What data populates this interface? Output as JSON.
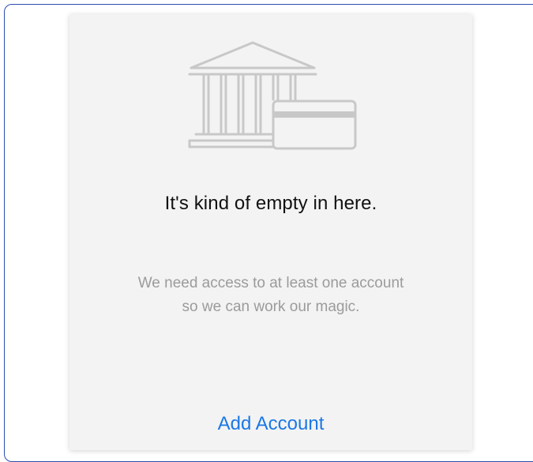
{
  "empty_state": {
    "title": "It's kind of empty in here.",
    "message_line1": "We need access to at least one account",
    "message_line2": "so we can work our magic.",
    "action_label": "Add Account",
    "illustration_icon": "bank-card-icon"
  },
  "colors": {
    "frame_border": "#2b4db0",
    "card_background": "#f3f3f3",
    "title": "#111111",
    "message": "#9b9b9b",
    "action": "#1a78e6",
    "illustration_stroke": "#c8c8c8"
  }
}
